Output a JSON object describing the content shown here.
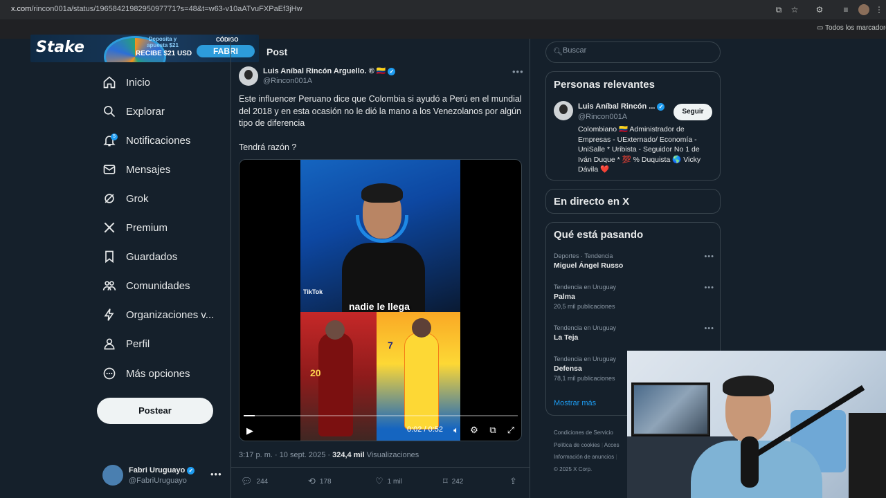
{
  "browser": {
    "url_host": "x.com",
    "url_path": "/rincon001a/status/1965842198295097771?s=48&t=w63-v10aATvuFXPaEf3jHw",
    "bookmarks_label": "Todos los marcadores"
  },
  "ad": {
    "brand": "Stake",
    "deposit_text": "Deposita y apuesta $21",
    "recibe_text": "RECIBE $21 USD",
    "code_label": "CÓDIGO",
    "code": "FABRI"
  },
  "nav": {
    "items": [
      {
        "label": "Inicio",
        "icon": "home-icon"
      },
      {
        "label": "Explorar",
        "icon": "search-icon"
      },
      {
        "label": "Notificaciones",
        "icon": "bell-icon",
        "badge": "5"
      },
      {
        "label": "Mensajes",
        "icon": "mail-icon"
      },
      {
        "label": "Grok",
        "icon": "grok-icon"
      },
      {
        "label": "Premium",
        "icon": "x-logo-icon"
      },
      {
        "label": "Guardados",
        "icon": "bookmark-icon"
      },
      {
        "label": "Comunidades",
        "icon": "people-icon"
      },
      {
        "label": "Organizaciones v...",
        "icon": "lightning-icon"
      },
      {
        "label": "Perfil",
        "icon": "person-icon"
      },
      {
        "label": "Más opciones",
        "icon": "more-circle-icon"
      }
    ],
    "post_button": "Postear",
    "me": {
      "name": "Fabri Uruguayo",
      "handle": "@FabriUruguayo"
    }
  },
  "post": {
    "heading": "Post",
    "author_name": "Luis Aníbal Rincón Arguello. ® 🇨🇴",
    "author_handle": "@Rincon001A",
    "text": "Este influencer Peruano dice que Colombia si ayudó a Perú en el mundial del 2018 y en esta ocasión no le dió la mano a los Venezolanos por algún tipo de diferencia",
    "question": "Tendrá razón ?",
    "video": {
      "watermark": "TikTok",
      "caption": "nadie le llega",
      "left_number": "20",
      "right_number": "7",
      "time": "0:02 / 0:52",
      "progress": 0.04
    },
    "meta_time": "3:17 p. m. · 10 sept. 2025 · ",
    "meta_views": "324,4 mil",
    "meta_views_label": " Visualizaciones",
    "actions": {
      "replies": "244",
      "reposts": "178",
      "likes": "1 mil",
      "bookmarks": "242"
    }
  },
  "search": {
    "placeholder": "Buscar"
  },
  "relevant": {
    "title": "Personas relevantes",
    "name": "Luis Aníbal Rincón ...",
    "handle": "@Rincon001A",
    "follow": "Seguir",
    "bio": "Colombiano 🇨🇴 Administrador de Empresas - UExternado/ Economía - UniSalle * Uribista - Seguidor No 1 de Iván Duque * 💯 % Duquista 🌎 Vicky Dávila ❤️"
  },
  "live": {
    "title": "En directo en X"
  },
  "trends": {
    "title": "Qué está pasando",
    "items": [
      {
        "category": "Deportes · Tendencia",
        "name": "Miguel Ángel Russo",
        "count": ""
      },
      {
        "category": "Tendencia en Uruguay",
        "name": "Palma",
        "count": "20,5 mil publicaciones"
      },
      {
        "category": "Tendencia en Uruguay",
        "name": "La Teja",
        "count": ""
      },
      {
        "category": "Tendencia en Uruguay",
        "name": "Defensa",
        "count": "78,1 mil publicaciones"
      }
    ],
    "show_more": "Mostrar más"
  },
  "footer": {
    "terms": "Condiciones de Servicio",
    "cookies": "Política de cookies",
    "access": "Acces",
    "ads": "Información de anuncios",
    "copyright": "© 2025 X Corp."
  }
}
